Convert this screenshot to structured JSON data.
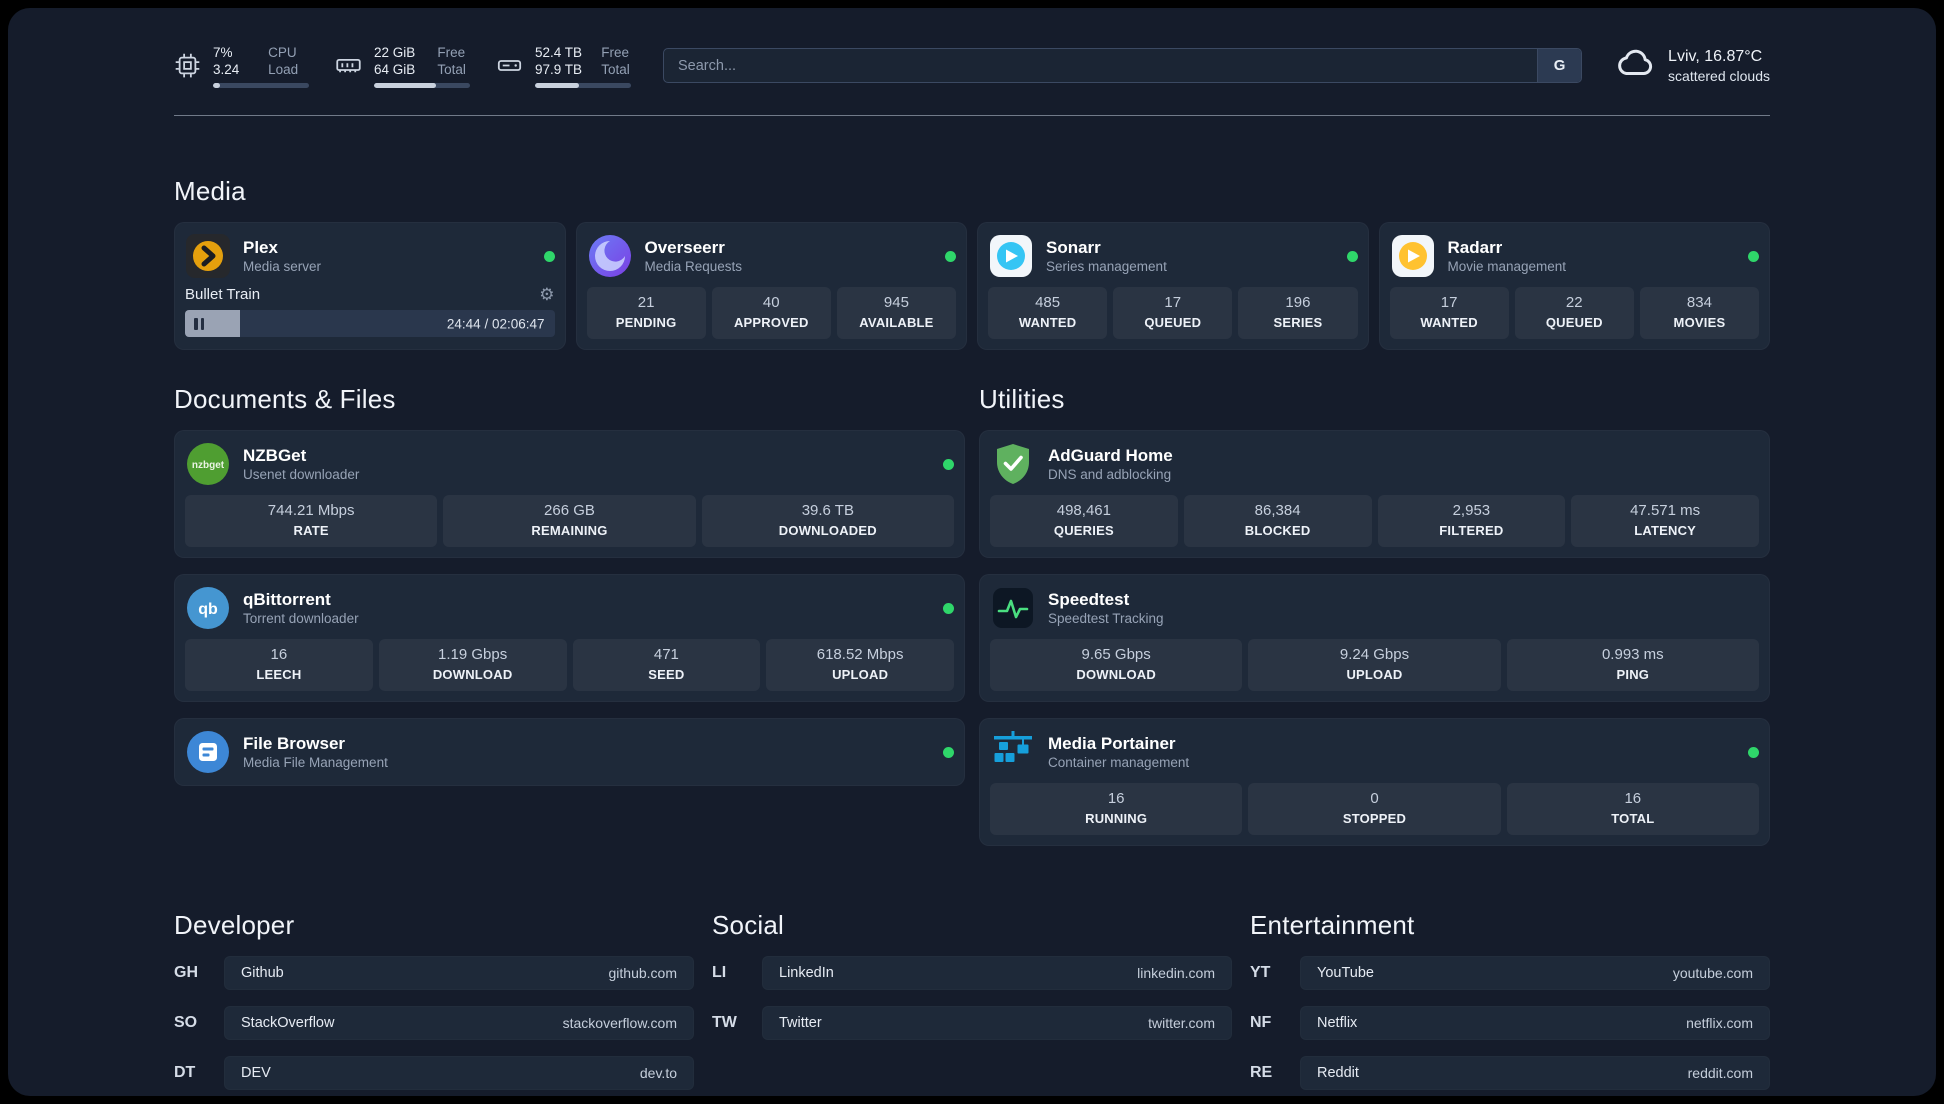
{
  "topbar": {
    "cpu": {
      "value1": "7%",
      "value2": "3.24",
      "label1": "CPU",
      "label2": "Load",
      "progress": 7
    },
    "ram": {
      "value1": "22 GiB",
      "value2": "64 GiB",
      "label1": "Free",
      "label2": "Total",
      "progress": 65
    },
    "disk": {
      "value1": "52.4 TB",
      "value2": "97.9 TB",
      "label1": "Free",
      "label2": "Total",
      "progress": 46
    },
    "search": {
      "placeholder": "Search...",
      "engine_label": "G"
    },
    "weather": {
      "location": "Lviv, 16.87°C",
      "condition": "scattered clouds"
    }
  },
  "media": {
    "heading": "Media",
    "plex": {
      "title": "Plex",
      "subtitle": "Media server",
      "now_playing": "Bullet Train",
      "time": "24:44 / 02:06:47",
      "progress": 15
    },
    "overseerr": {
      "title": "Overseerr",
      "subtitle": "Media Requests",
      "stats": [
        {
          "value": "21",
          "label": "PENDING"
        },
        {
          "value": "40",
          "label": "APPROVED"
        },
        {
          "value": "945",
          "label": "AVAILABLE"
        }
      ]
    },
    "sonarr": {
      "title": "Sonarr",
      "subtitle": "Series management",
      "stats": [
        {
          "value": "485",
          "label": "WANTED"
        },
        {
          "value": "17",
          "label": "QUEUED"
        },
        {
          "value": "196",
          "label": "SERIES"
        }
      ]
    },
    "radarr": {
      "title": "Radarr",
      "subtitle": "Movie management",
      "stats": [
        {
          "value": "17",
          "label": "WANTED"
        },
        {
          "value": "22",
          "label": "QUEUED"
        },
        {
          "value": "834",
          "label": "MOVIES"
        }
      ]
    }
  },
  "documents": {
    "heading": "Documents & Files",
    "nzbget": {
      "title": "NZBGet",
      "subtitle": "Usenet downloader",
      "icon_text": "nzbget",
      "stats": [
        {
          "value": "744.21 Mbps",
          "label": "RATE"
        },
        {
          "value": "266 GB",
          "label": "REMAINING"
        },
        {
          "value": "39.6 TB",
          "label": "DOWNLOADED"
        }
      ]
    },
    "qbittorrent": {
      "title": "qBittorrent",
      "subtitle": "Torrent downloader",
      "icon_text": "qb",
      "stats": [
        {
          "value": "16",
          "label": "LEECH"
        },
        {
          "value": "1.19 Gbps",
          "label": "DOWNLOAD"
        },
        {
          "value": "471",
          "label": "SEED"
        },
        {
          "value": "618.52 Mbps",
          "label": "UPLOAD"
        }
      ]
    },
    "filebrowser": {
      "title": "File Browser",
      "subtitle": "Media File Management"
    }
  },
  "utilities": {
    "heading": "Utilities",
    "adguard": {
      "title": "AdGuard Home",
      "subtitle": "DNS and adblocking",
      "stats": [
        {
          "value": "498,461",
          "label": "QUERIES"
        },
        {
          "value": "86,384",
          "label": "BLOCKED"
        },
        {
          "value": "2,953",
          "label": "FILTERED"
        },
        {
          "value": "47.571 ms",
          "label": "LATENCY"
        }
      ]
    },
    "speedtest": {
      "title": "Speedtest",
      "subtitle": "Speedtest Tracking",
      "stats": [
        {
          "value": "9.65 Gbps",
          "label": "DOWNLOAD"
        },
        {
          "value": "9.24 Gbps",
          "label": "UPLOAD"
        },
        {
          "value": "0.993 ms",
          "label": "PING"
        }
      ]
    },
    "portainer": {
      "title": "Media Portainer",
      "subtitle": "Container management",
      "stats": [
        {
          "value": "16",
          "label": "RUNNING"
        },
        {
          "value": "0",
          "label": "STOPPED"
        },
        {
          "value": "16",
          "label": "TOTAL"
        }
      ]
    }
  },
  "link_sections": {
    "developer": {
      "heading": "Developer",
      "items": [
        {
          "abbr": "GH",
          "name": "Github",
          "url": "github.com"
        },
        {
          "abbr": "SO",
          "name": "StackOverflow",
          "url": "stackoverflow.com"
        },
        {
          "abbr": "DT",
          "name": "DEV",
          "url": "dev.to"
        }
      ]
    },
    "social": {
      "heading": "Social",
      "items": [
        {
          "abbr": "LI",
          "name": "LinkedIn",
          "url": "linkedin.com"
        },
        {
          "abbr": "TW",
          "name": "Twitter",
          "url": "twitter.com"
        }
      ]
    },
    "entertainment": {
      "heading": "Entertainment",
      "items": [
        {
          "abbr": "YT",
          "name": "YouTube",
          "url": "youtube.com"
        },
        {
          "abbr": "NF",
          "name": "Netflix",
          "url": "netflix.com"
        },
        {
          "abbr": "RE",
          "name": "Reddit",
          "url": "reddit.com"
        }
      ]
    }
  },
  "colors": {
    "status_green": "#2fd66a",
    "plex_amber": "#e5a00d",
    "sonarr_blue": "#35c5f4",
    "radarr_amber": "#ffc230",
    "overseerr_purple": "#6366f1",
    "nzbget_green": "#4f9e31",
    "qbittorrent_blue": "#4596d1",
    "filebrowser_blue": "#3d87d6",
    "adguard_green": "#5fb15f",
    "portainer_blue": "#169fdb",
    "speedtest_green": "#4ade80"
  }
}
